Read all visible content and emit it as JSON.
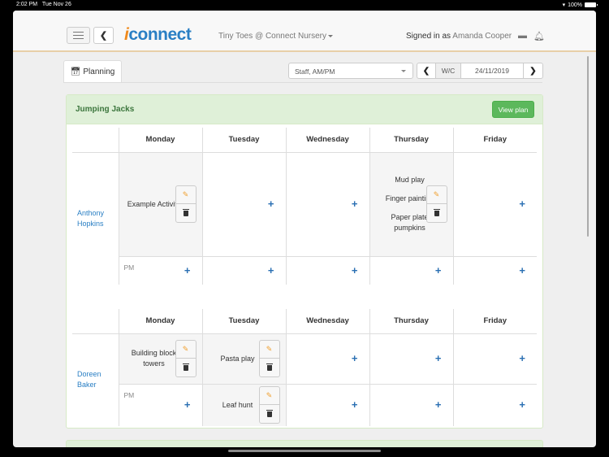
{
  "statusbar": {
    "time": "2:02 PM",
    "date": "Tue Nov 26",
    "battery": "100%"
  },
  "navbar": {
    "logo_i": "i",
    "logo_rest": "connect",
    "org": "Tiny Toes @ Connect Nursery",
    "signed_prefix": "Signed in as",
    "user": "Amanda Cooper",
    "messages_icon": "comment-icon",
    "notifications_icon": "bell-icon"
  },
  "tabs": {
    "planning": "Planning"
  },
  "filters": {
    "staff_select": "Staff, AM/PM",
    "week_label": "W/C",
    "week_date": "24/11/2019"
  },
  "room": {
    "title": "Jumping Jacks",
    "view_plan": "View plan"
  },
  "days": [
    "Monday",
    "Tuesday",
    "Wednesday",
    "Thursday",
    "Friday"
  ],
  "pm_label": "PM",
  "staff": [
    {
      "first": "Anthony",
      "last": "Hopkins",
      "am": [
        [
          "Example Activity"
        ],
        [],
        [],
        [
          "Mud play",
          "Finger painting",
          "Paper plate pumpkins"
        ],
        []
      ],
      "pm": [
        [],
        [],
        [],
        [],
        []
      ]
    },
    {
      "first": "Doreen",
      "last": "Baker",
      "am": [
        [
          "Building block towers"
        ],
        [
          "Pasta play"
        ],
        [],
        [],
        []
      ],
      "pm": [
        [],
        [
          "Leaf hunt"
        ],
        [],
        [],
        []
      ]
    }
  ]
}
